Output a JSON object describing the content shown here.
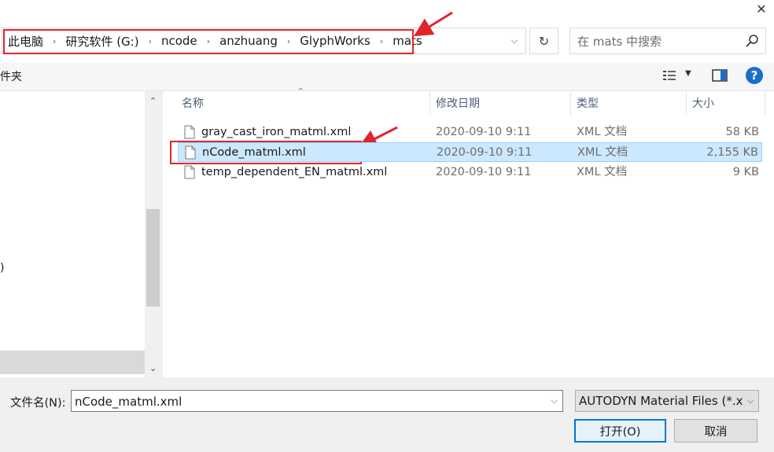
{
  "window": {
    "close_label": "✕"
  },
  "address": {
    "crumbs": [
      "此电脑",
      "研究软件 (G:)",
      "ncode",
      "anzhuang",
      "GlyphWorks",
      "mats"
    ],
    "separator": "›",
    "dropdown": "⌵",
    "refresh": "↻"
  },
  "search": {
    "placeholder": "在 mats 中搜索"
  },
  "toolbar": {
    "new_folder_label": "件夹",
    "help_label": "?"
  },
  "nav": {
    "partial_text": ")",
    "scroll_up": "⌃",
    "scroll_down": "⌄"
  },
  "columns": {
    "name": "名称",
    "date": "修改日期",
    "type": "类型",
    "size": "大小",
    "sort_caret": "^"
  },
  "files": [
    {
      "name": "gray_cast_iron_matml.xml",
      "date": "2020-09-10 9:11",
      "type": "XML 文档",
      "size": "58 KB",
      "selected": false
    },
    {
      "name": "nCode_matml.xml",
      "date": "2020-09-10 9:11",
      "type": "XML 文档",
      "size": "2,155 KB",
      "selected": true
    },
    {
      "name": "temp_dependent_EN_matml.xml",
      "date": "2020-09-10 9:11",
      "type": "XML 文档",
      "size": "9 KB",
      "selected": false
    }
  ],
  "footer": {
    "filename_label": "文件名(N):",
    "filename_value": "nCode_matml.xml",
    "filetype_value": "AUTODYN Material Files (*.xml)",
    "open_label": "打开(O)",
    "cancel_label": "取消",
    "caret": "⌵"
  },
  "colors": {
    "selected_row": "#cce8ff",
    "annotation_red": "#e0262b",
    "accent": "#0078d7"
  }
}
